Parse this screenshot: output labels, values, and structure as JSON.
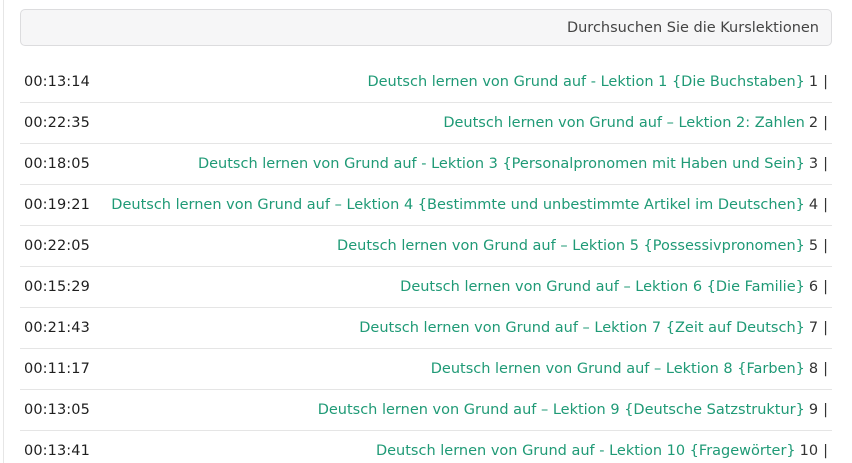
{
  "search": {
    "placeholder": "Durchsuchen Sie die Kurslektionen"
  },
  "separator": "|",
  "lessons": [
    {
      "duration": "00:13:14",
      "title": "Deutsch lernen von Grund auf - Lektion 1 {Die Buchstaben}",
      "number": "1"
    },
    {
      "duration": "00:22:35",
      "title": "Deutsch lernen von Grund auf – Lektion 2: Zahlen",
      "number": "2"
    },
    {
      "duration": "00:18:05",
      "title": "Deutsch lernen von Grund auf - Lektion 3 {Personalpronomen mit Haben und Sein}",
      "number": "3"
    },
    {
      "duration": "00:19:21",
      "title": "Deutsch lernen von Grund auf – Lektion 4 {Bestimmte und unbestimmte Artikel im Deutschen}",
      "number": "4"
    },
    {
      "duration": "00:22:05",
      "title": "Deutsch lernen von Grund auf – Lektion 5 {Possessivpronomen}",
      "number": "5"
    },
    {
      "duration": "00:15:29",
      "title": "Deutsch lernen von Grund auf – Lektion 6 {Die Familie}",
      "number": "6"
    },
    {
      "duration": "00:21:43",
      "title": "Deutsch lernen von Grund auf – Lektion 7 {Zeit auf Deutsch}",
      "number": "7"
    },
    {
      "duration": "00:11:17",
      "title": "Deutsch lernen von Grund auf – Lektion 8 {Farben}",
      "number": "8"
    },
    {
      "duration": "00:13:05",
      "title": "Deutsch lernen von Grund auf – Lektion 9 {Deutsche Satzstruktur}",
      "number": "9"
    },
    {
      "duration": "00:13:41",
      "title": "Deutsch lernen von Grund auf - Lektion 10 {Fragewörter}",
      "number": "10"
    }
  ]
}
